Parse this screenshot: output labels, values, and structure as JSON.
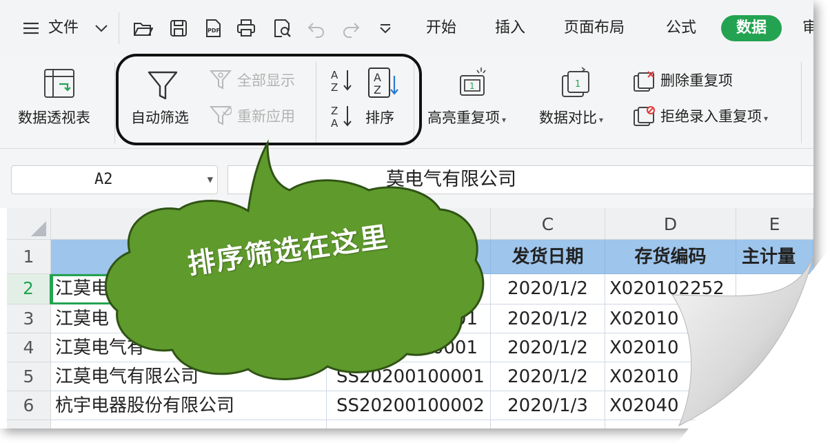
{
  "menubar": {
    "file_label": "文件",
    "tabs": [
      "开始",
      "插入",
      "页面布局",
      "公式"
    ],
    "active_tab": "数据",
    "clipped_tab": "审"
  },
  "ribbon": {
    "pivot_label": "数据透视表",
    "autofilter_label": "自动筛选",
    "show_all_label": "全部显示",
    "reapply_label": "重新应用",
    "sort_label": "排序",
    "highlight_dup_label": "高亮重复项",
    "compare_label": "数据对比",
    "remove_dup_label": "删除重复项",
    "reject_dup_label": "拒绝录入重复项"
  },
  "formula_bar": {
    "cell_ref": "A2",
    "content_visible": "莫电气有限公司"
  },
  "sheet": {
    "columns": [
      "C",
      "D",
      "E"
    ],
    "rows": [
      "1",
      "2",
      "3",
      "4",
      "5",
      "6"
    ],
    "headers": [
      "发货日期",
      "存货编码",
      "主计量"
    ],
    "col_a": [
      "江莫电",
      "江莫电",
      "江莫电气有",
      "江莫电气有限公司",
      "杭宇电器股份有限公司"
    ],
    "col_b": [
      "",
      "01",
      "00100001",
      "SS20200100001",
      "SS20200100002"
    ],
    "col_c": [
      "2020/1/2",
      "2020/1/2",
      "2020/1/2",
      "2020/1/2",
      "2020/1/3"
    ],
    "col_d": [
      "X020102252",
      "X02010",
      "X02010",
      "X02010",
      "X02040"
    ]
  },
  "callout": {
    "text": "排序筛选在这里",
    "color": "#5f9a2c"
  },
  "colors": {
    "accent": "#23a351",
    "header_fill": "#9ec5ec"
  },
  "icons": [
    "menu-icon",
    "chevron-down-icon",
    "open-folder-icon",
    "save-icon",
    "pdf-icon",
    "print-icon",
    "print-preview-icon",
    "undo-icon",
    "redo-icon",
    "pivot-table-icon",
    "filter-icon",
    "show-all-icon",
    "reapply-icon",
    "sort-asc-icon",
    "sort-desc-icon",
    "sort-icon",
    "highlight-dup-icon",
    "compare-icon",
    "remove-dup-icon",
    "reject-dup-icon"
  ]
}
